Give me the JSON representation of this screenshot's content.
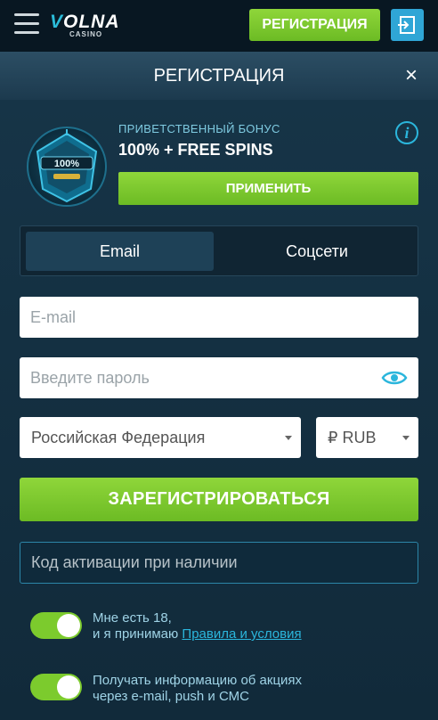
{
  "header": {
    "logo_text_a": "V",
    "logo_text_b": "OLNA",
    "logo_sub": "CASINO",
    "register_label": "РЕГИСТРАЦИЯ",
    "menu_icon": "hamburger-icon",
    "login_icon": "login-icon"
  },
  "modal": {
    "title": "РЕГИСТРАЦИЯ",
    "close_label": "×"
  },
  "bonus": {
    "label": "ПРИВЕТСТВЕННЫЙ БОНУС",
    "title": "100% + FREE SPINS",
    "apply_label": "ПРИМЕНИТЬ",
    "badge_text": "100%",
    "info_label": "i"
  },
  "tabs": [
    {
      "label": "Email",
      "active": true
    },
    {
      "label": "Соцсети",
      "active": false
    }
  ],
  "form": {
    "email_placeholder": "E-mail",
    "password_placeholder": "Введите пароль",
    "country_value": "Российская Федерация",
    "currency_value": "₽ RUB",
    "submit_label": "ЗАРЕГИСТРИРОВАТЬСЯ",
    "activation_placeholder": "Код активации при наличии"
  },
  "consents": {
    "age_line1": "Мне есть 18,",
    "age_line2_prefix": "и я принимаю ",
    "age_link": "Правила и условия",
    "age_checked": true,
    "promo_line1": "Получать информацию об акциях",
    "promo_line2": "через e-mail, push и СМС",
    "promo_checked": true
  },
  "colors": {
    "accent_green": "#7ccb2d",
    "accent_blue": "#2bb6dc",
    "background": "#0b1d2a"
  }
}
